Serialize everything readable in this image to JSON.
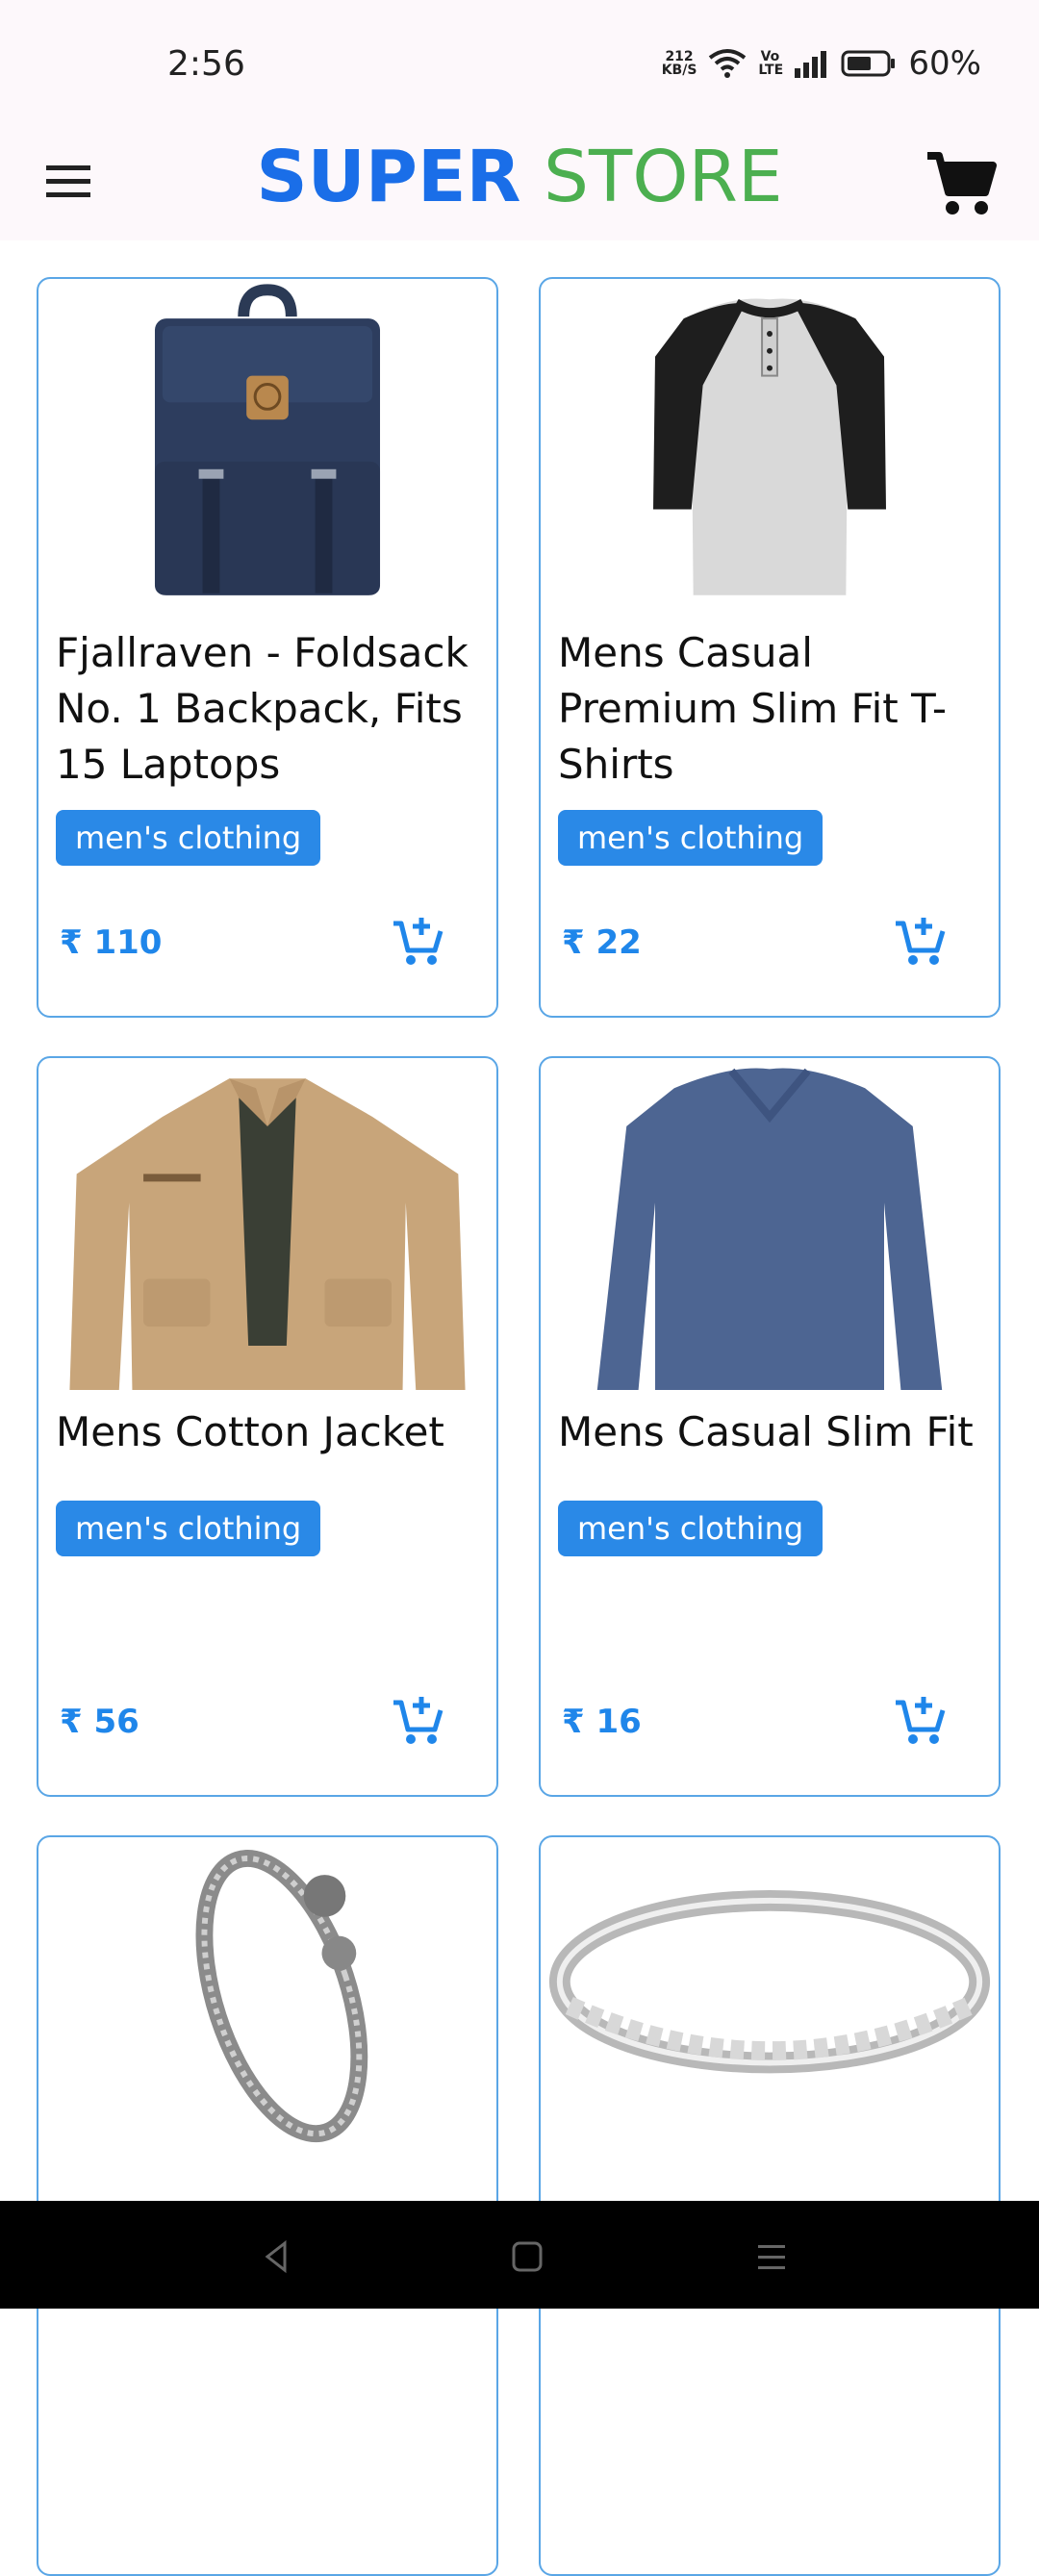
{
  "status": {
    "time": "2:56",
    "kbs_top": "212",
    "kbs_bottom": "KB/S",
    "volte": "Vo LTE",
    "battery": "60%"
  },
  "header": {
    "title_part1": "SUPER",
    "title_part2": "STORE",
    "menu_icon": "hamburger-menu-icon",
    "cart_icon": "shopping-cart-icon"
  },
  "products": [
    {
      "name": "Fjallraven - Foldsack No. 1 Backpack, Fits 15 Laptops",
      "category": "men's clothing",
      "price": "₹ 110",
      "image": "backpack"
    },
    {
      "name": "Mens Casual Premium Slim Fit T-Shirts",
      "category": "men's clothing",
      "price": "₹ 22",
      "image": "raglan-shirt"
    },
    {
      "name": "Mens Cotton Jacket",
      "category": "men's clothing",
      "price": "₹ 56",
      "image": "jacket"
    },
    {
      "name": "Mens Casual Slim Fit",
      "category": "men's clothing",
      "price": "₹ 16",
      "image": "long-sleeve-shirt"
    },
    {
      "name": "",
      "category": "",
      "price": "",
      "image": "bracelet"
    },
    {
      "name": "",
      "category": "",
      "price": "",
      "image": "ring"
    }
  ],
  "colors": {
    "accent": "#2a89e7",
    "title_blue": "#1a6ee8",
    "title_green": "#4caf50",
    "card_border": "#5aa6e6"
  }
}
